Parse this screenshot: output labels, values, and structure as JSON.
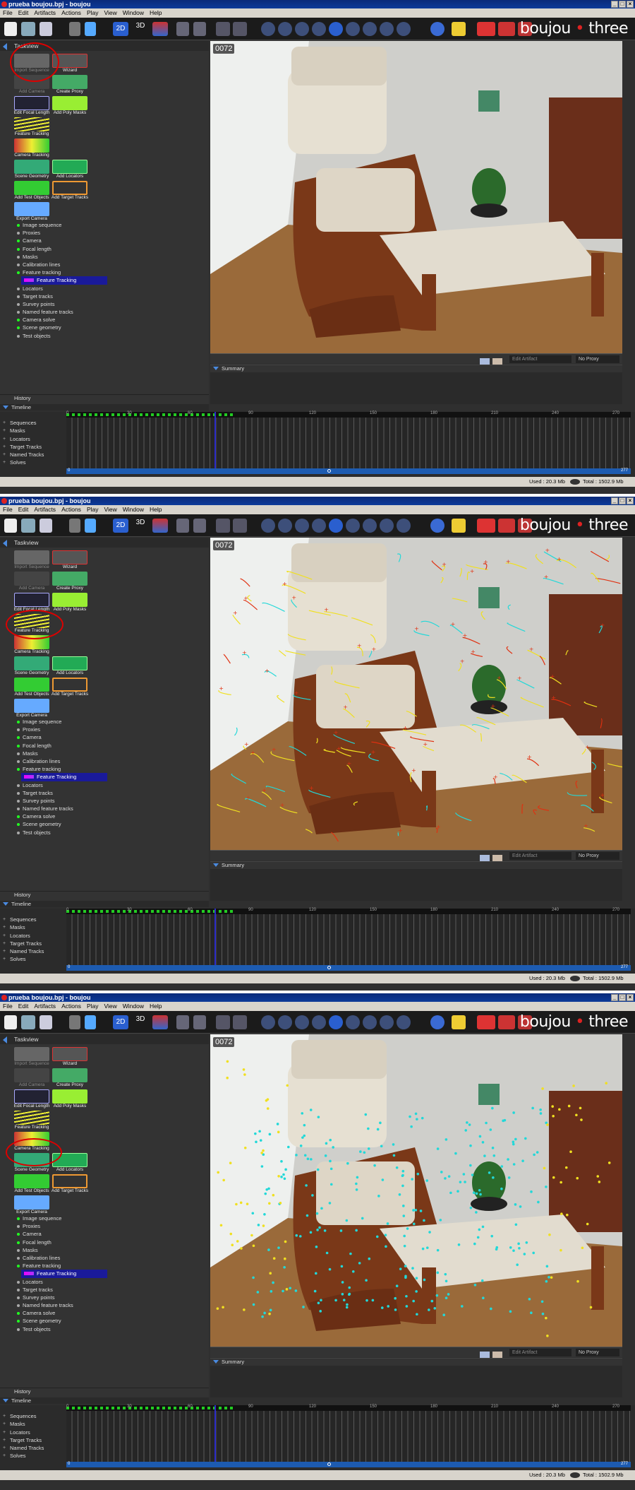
{
  "window": {
    "title": "prueba boujou.bpj - boujou",
    "buttons": [
      "_",
      "□",
      "×"
    ]
  },
  "menu": [
    "File",
    "Edit",
    "Artifacts",
    "Actions",
    "Play",
    "View",
    "Window",
    "Help"
  ],
  "toolbar": {
    "brand_text": "boujou",
    "brand_mid": "•",
    "brand_suffix": "three",
    "mode_2d": "2D",
    "mode_3d": "3D"
  },
  "taskview": {
    "header": "Taskview",
    "tasks": {
      "import": "Import Sequence",
      "wizard": "Wizard",
      "add_camera": "Add Camera",
      "create_proxy": "Create Proxy",
      "edit_focal": "Edit Focal Length",
      "add_poly": "Add Poly Masks",
      "feature_tracking": "Feature Tracking",
      "camera_tracking": "Camera Tracking",
      "scene_geometry": "Scene Geometry",
      "add_locators": "Add Locators",
      "add_test": "Add Test Objects",
      "add_target": "Add Target Tracks",
      "export_camera": "Export Camera"
    }
  },
  "tree": [
    "Image sequence",
    "Proxies",
    "Camera",
    "Focal length",
    "Masks",
    "Calibration lines",
    "Feature tracking",
    "Feature Tracking",
    "Locators",
    "Target tracks",
    "Survey points",
    "Named feature tracks",
    "Camera solve",
    "Scene geometry",
    "Test objects"
  ],
  "tree_green": [
    true,
    false,
    true,
    true,
    false,
    false,
    true,
    null,
    false,
    false,
    false,
    false,
    true,
    true,
    false
  ],
  "viewport": {
    "frame": "0072",
    "edit_artifact": "Edit Artifact",
    "proxy": "No Proxy",
    "summary": "Summary"
  },
  "history": "History",
  "timeline": {
    "header": "Timeline",
    "rows": [
      "Sequences",
      "Masks",
      "Locators",
      "Target Tracks",
      "Named Tracks",
      "Solves"
    ],
    "ticks": [
      "0",
      "30",
      "60",
      "90",
      "120",
      "150",
      "180",
      "210",
      "240",
      "270"
    ],
    "start": "0",
    "end": "277"
  },
  "status": {
    "used": "Used : 20.3 Mb",
    "total": "Total : 1502.9 Mb"
  },
  "colors": {
    "title_bar": "#0d3a99",
    "highlight_circle": "#dd0000",
    "track_cyan": "#22d8d8",
    "track_yellow": "#f0e020",
    "track_red": "#e03010"
  }
}
